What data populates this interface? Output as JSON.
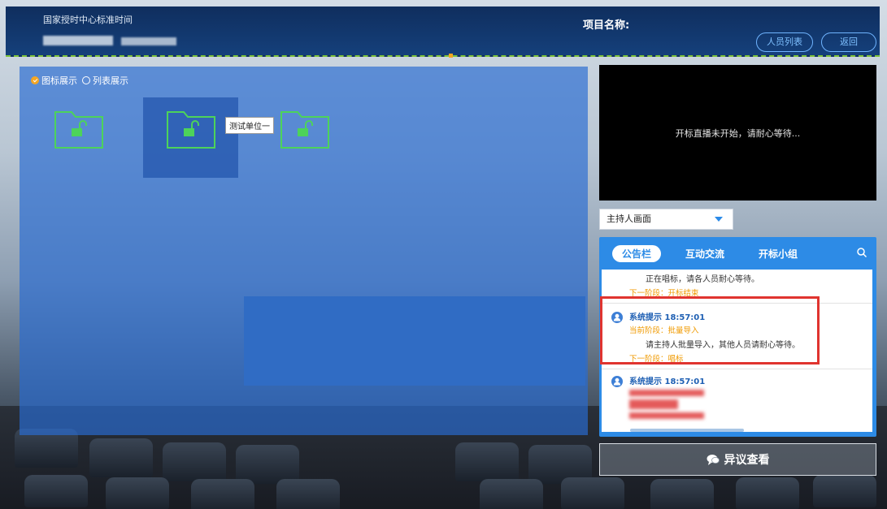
{
  "header": {
    "clock_label": "国家授时中心标准时间",
    "project_label": "项目名称:",
    "people_btn": "人员列表",
    "back_btn": "返回"
  },
  "view_options": {
    "icon_view": "图标展示",
    "list_view": "列表展示",
    "selected": "icon"
  },
  "folders": [
    {
      "icon": "folder-unlock-icon"
    },
    {
      "icon": "folder-unlock-icon",
      "selected": true
    },
    {
      "icon": "folder-unlock-icon"
    }
  ],
  "tooltip": "测试单位一",
  "video": {
    "status": "开标直播未开始，请耐心等待..."
  },
  "camera_select": {
    "value": "主持人画面"
  },
  "notice": {
    "tabs": [
      "公告栏",
      "互动交流",
      "开标小组"
    ],
    "active_tab": 0,
    "messages": [
      {
        "body": "正在唱标，请各人员耐心等待。",
        "next": "下一阶段：开标结束"
      },
      {
        "head": "系统提示 18:57:01",
        "current": "当前阶段：批量导入",
        "body": "请主持人批量导入，其他人员请耐心等待。",
        "next": "下一阶段：唱标"
      },
      {
        "head": "系统提示 18:57:01"
      }
    ]
  },
  "dispute_btn": "异议查看",
  "colors": {
    "accent": "#2d8be6",
    "highlight": "#e0342f",
    "folder": "#4dd35a",
    "orange": "#f09a00"
  }
}
